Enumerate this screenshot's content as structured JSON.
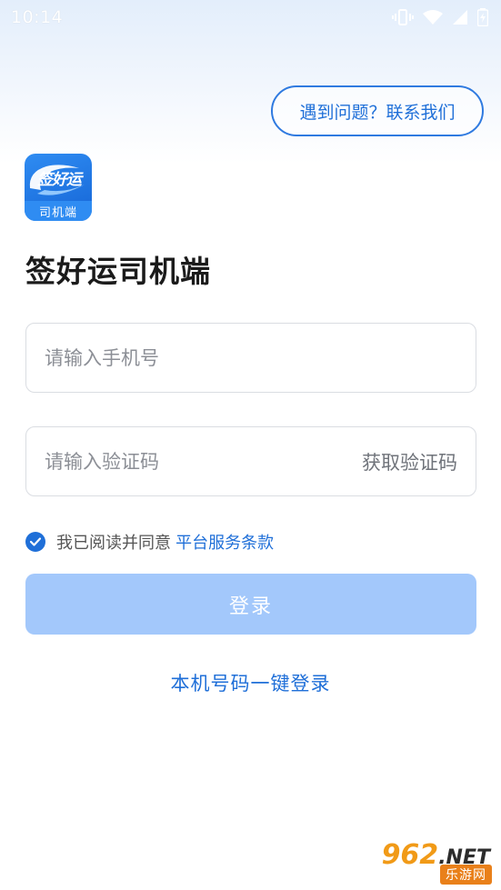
{
  "status_bar": {
    "time": "10:14"
  },
  "header": {
    "help_label": "遇到问题？联系我们"
  },
  "logo": {
    "brand_text": "签好运",
    "sub_text": "司机端"
  },
  "page": {
    "title": "签好运司机端"
  },
  "form": {
    "phone_placeholder": "请输入手机号",
    "phone_value": "",
    "code_placeholder": "请输入验证码",
    "code_value": "",
    "get_code_label": "获取验证码"
  },
  "agreement": {
    "checked": true,
    "text": "我已阅读并同意",
    "link": "平台服务条款"
  },
  "actions": {
    "login_label": "登录",
    "one_key_label": "本机号码一键登录"
  },
  "watermark": {
    "top": "962",
    "net": ".NET",
    "bottom": "乐游网"
  },
  "colors": {
    "accent": "#1f6fd8",
    "login_disabled": "#a3c8fb",
    "field_border": "#dadde2"
  }
}
